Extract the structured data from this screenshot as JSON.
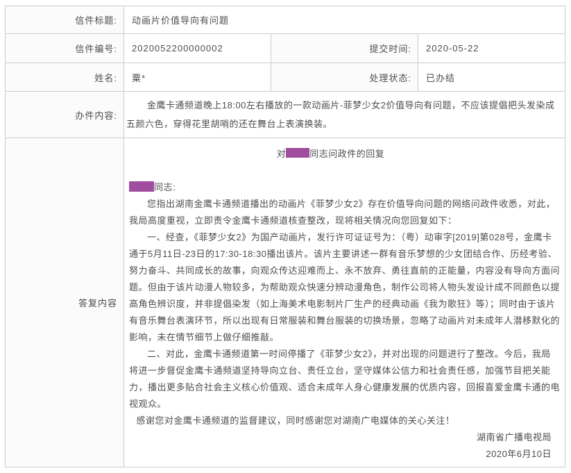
{
  "colors": {
    "redaction": "#a14d9f",
    "table_border": "#cccccc",
    "label_bg": "#fbfbfb",
    "text": "#4d4d4d"
  },
  "fields": {
    "title_label": "信件标题:",
    "title_value": "动画片价值导向有问题",
    "number_label": "信件编号:",
    "number_value": "2020052200000002",
    "submit_time_label": "提交时间:",
    "submit_time_value": "2020-05-22",
    "name_label": "姓名:",
    "name_value": "粟*",
    "status_label": "处理状态:",
    "status_value": "已办结",
    "content_label": "办件内容:",
    "content_value": "金鹰卡通频道晚上18:00左右播放的一款动画片-菲梦少女2价值导向有问题，不应该提倡把头发染成五颜六色，穿得花里胡哨的还在舞台上表演换装。",
    "reply_label": "答复内容"
  },
  "reply": {
    "title_prefix": "对",
    "title_suffix": "同志问政件的回复",
    "salutation_suffix": "同志:",
    "paragraphs": [
      "您指出湖南金鹰卡通频道播出的动画片《菲梦少女2》存在价值导向问题的网络问政件收悉，对此，我局高度重视，立即责令金鹰卡通频道核查整改，现将相关情况向您回复如下：",
      "一、经查，《菲梦少女2》为国产动画片，发行许可证证号为：（粤）动审字[2019]第028号，金鹰卡通于5月11日-23日的17:30-18:30播出该片。该片主要讲述一群有音乐梦想的少女团结合作、历经考验、努力奋斗、共同成长的故事，向观众传达迎难而上、永不放弃、勇往直前的正能量，内容没有导向方面问题。但由于该片动漫人物较多，为帮助观众快速分辨动漫角色，制作公司将人物头发设计成不同颜色以提高角色辨识度，并非提倡染发（如上海美术电影制片厂生产的经典动画《我为歌狂》等）；同时由于该片有音乐舞台表演环节，所以出现有日常服装和舞台服装的切换场景，忽略了动画片对未成年人潜移默化的影响，未在情节细节上做仔细推敲。",
      "二、对此，金鹰卡通频道第一时间停播了《菲梦少女2》，并对出现的问题进行了整改。今后，我局将进一步督促金鹰卡通频道坚持导向立台、责任立台，坚守媒体公信力和社会责任感，加强节目把关能力，播出更多贴合社会主义核心价值观、适合未成年人身心健康发展的优质内容，回报喜爱金鹰卡通的电视观众。"
    ],
    "thanks": "感谢您对金鹰卡通频道的监督建议，同时感谢您对湖南广电媒体的关心关注！",
    "signature": "湖南省广播电视局",
    "date": "2020年6月10日"
  }
}
